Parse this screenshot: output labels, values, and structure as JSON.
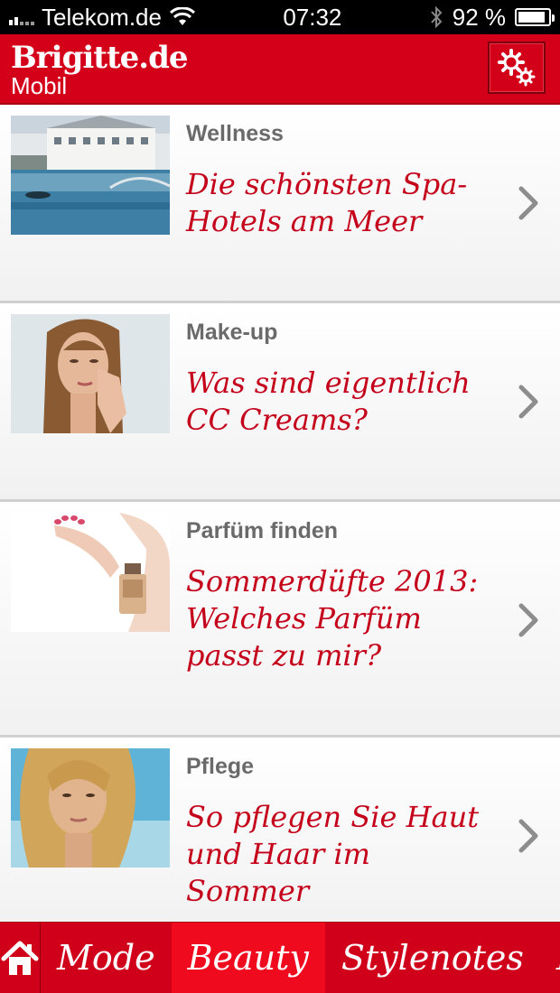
{
  "status_bar": {
    "carrier": "Telekom.de",
    "time": "07:32",
    "battery_percent": "92 %",
    "battery_level": 0.92
  },
  "header": {
    "brand": "Brigitte.de",
    "subtitle": "Mobil",
    "settings_icon": "gears-icon"
  },
  "colors": {
    "brand_red": "#d4001a",
    "headline_red": "#c4001a",
    "category_gray": "#6a6a6a"
  },
  "articles": [
    {
      "category": "Wellness",
      "title": "Die schönsten Spa-Hotels am Meer"
    },
    {
      "category": "Make-up",
      "title": "Was sind eigentlich CC Creams?"
    },
    {
      "category": "Parfüm finden",
      "title": "Sommerdüfte 2013: Welches Parfüm passt zu mir?"
    },
    {
      "category": "Pflege",
      "title": "So pflegen Sie Haut und Haar im Sommer"
    }
  ],
  "tabbar": {
    "home_icon": "home-icon",
    "tabs": [
      {
        "label": "Mode"
      },
      {
        "label": "Beauty",
        "active": true
      },
      {
        "label": "Stylenotes"
      },
      {
        "label": "L"
      }
    ]
  }
}
